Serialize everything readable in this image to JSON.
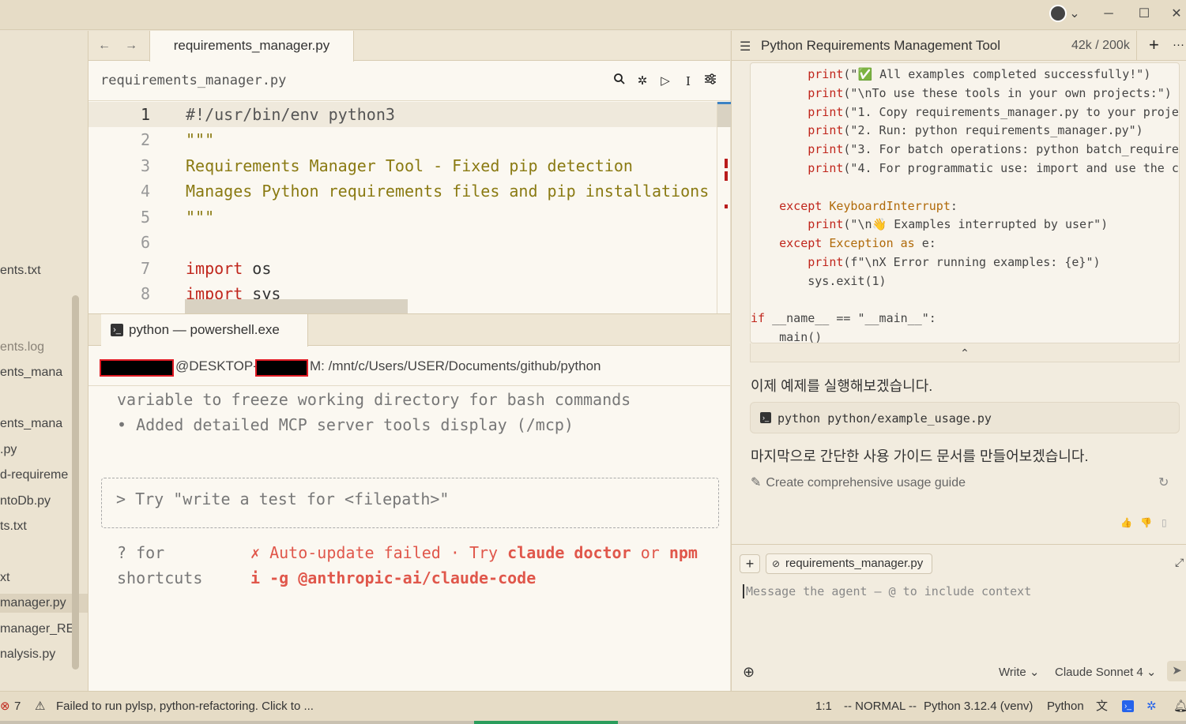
{
  "titlebar": {
    "minimize": "─",
    "maximize": "☐",
    "close": "✕",
    "dropdown": "⌄"
  },
  "sidebar": {
    "items": [
      {
        "label": "ents.txt",
        "style": "normal"
      },
      {
        "label": "ents.log",
        "style": "dim"
      },
      {
        "label": "ents_mana",
        "style": "normal"
      },
      {
        "label": "ents_mana",
        "style": "normal"
      },
      {
        "label": ".py",
        "style": "normal"
      },
      {
        "label": "d-requireme",
        "style": "normal"
      },
      {
        "label": "ntoDb.py",
        "style": "normal"
      },
      {
        "label": "ts.txt",
        "style": "normal"
      },
      {
        "label": "xt",
        "style": "normal"
      },
      {
        "label": "manager.py",
        "style": "active"
      },
      {
        "label": "manager_RE",
        "style": "normal"
      },
      {
        "label": "nalysis.py",
        "style": "normal"
      }
    ]
  },
  "editor": {
    "tab_label": "requirements_manager.py",
    "file_name": "requirements_manager.py",
    "back": "←",
    "forward": "→",
    "lines": [
      {
        "n": "1",
        "text": "#!/usr/bin/env python3"
      },
      {
        "n": "2",
        "text": "\"\"\""
      },
      {
        "n": "3",
        "text": "Requirements Manager Tool - Fixed pip detection"
      },
      {
        "n": "4",
        "text": "Manages Python requirements files and pip installations"
      },
      {
        "n": "5",
        "text": "\"\"\""
      },
      {
        "n": "6",
        "text": ""
      },
      {
        "n": "7",
        "kw": "import",
        "rest": " os"
      },
      {
        "n": "8",
        "kw": "import",
        "rest": " sys"
      }
    ]
  },
  "terminal": {
    "tab_label": "python — powershell.exe",
    "prompt_host": "@DESKTOP-",
    "prompt_path": "M: /mnt/c/Users/USER/Documents/github/python",
    "line1": "variable to freeze working directory for bash commands",
    "line2": "• Added detailed MCP server tools display (/mcp)",
    "input_placeholder": "> Try \"write a test for <filepath>\"",
    "help1": "? for",
    "help2": "shortcuts",
    "err_a": "✗ Auto-update failed · Try ",
    "err_b": "claude doctor",
    "err_c": " or ",
    "err_d": "npm",
    "err_e": "i -g @anthropic-ai/claude-code"
  },
  "chat": {
    "title": "Python Requirements Management Tool",
    "tokens": "42k / 200k",
    "plus": "+",
    "more": "···",
    "code_lines": [
      {
        "indent": "        ",
        "fn": "print",
        "rest": "(\"✅ All examples completed successfully!\")"
      },
      {
        "indent": "        ",
        "fn": "print",
        "rest": "(\"\\nTo use these tools in your own projects:\")"
      },
      {
        "indent": "        ",
        "fn": "print",
        "rest": "(\"1. Copy requirements_manager.py to your proje"
      },
      {
        "indent": "        ",
        "fn": "print",
        "rest": "(\"2. Run: python requirements_manager.py\")"
      },
      {
        "indent": "        ",
        "fn": "print",
        "rest": "(\"3. For batch operations: python batch_require"
      },
      {
        "indent": "        ",
        "fn": "print",
        "rest": "(\"4. For programmatic use: import and use the c"
      },
      {
        "indent": "",
        "fn": "",
        "rest": ""
      },
      {
        "indent": "    ",
        "fn": "except",
        "ex": " KeyboardInterrupt",
        "rest": ":"
      },
      {
        "indent": "        ",
        "fn": "print",
        "rest": "(\"\\n👋 Examples interrupted by user\")"
      },
      {
        "indent": "    ",
        "fn": "except",
        "ex": " Exception",
        "kw2": " as",
        "rest": " e:"
      },
      {
        "indent": "        ",
        "fn": "print",
        "rest": "(f\"\\nX Error running examples: {e}\")"
      },
      {
        "indent": "        ",
        "fn": "",
        "rest": "sys.exit(1)"
      },
      {
        "indent": "",
        "fn": "",
        "rest": ""
      },
      {
        "indent": "",
        "fn": "if",
        "rest": " __name__ == \"__main__\":"
      },
      {
        "indent": "    ",
        "fn": "",
        "rest": "main()"
      }
    ],
    "collapse": "⌃",
    "msg1": "이제 예제를 실행해보겠습니다.",
    "command": "python python/example_usage.py",
    "msg2": "마지막으로 간단한 사용 가이드 문서를 만들어보겠습니다.",
    "task": "Create comprehensive usage guide",
    "context_chip": "requirements_manager.py",
    "input_placeholder": "Message the agent – @ to include context",
    "mode": "Write",
    "model": "Claude Sonnet 4"
  },
  "statusbar": {
    "error_count": "7",
    "warning_text": "Failed to run pylsp, python-refactoring. Click to ...",
    "position": "1:1",
    "mode": "-- NORMAL --",
    "interpreter": "Python 3.12.4 (venv)",
    "language": "Python"
  },
  "colors": {
    "accent": "#3b82c4",
    "error": "#e0574b",
    "keyword": "#c0261c",
    "docstring": "#8a7a12"
  }
}
